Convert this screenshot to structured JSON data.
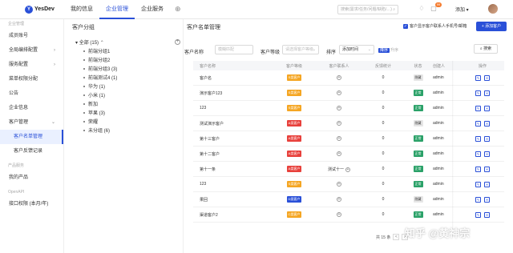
{
  "brand": {
    "name": "YesDev",
    "logo_letter": "Y"
  },
  "topnav": {
    "items": [
      "我的信息",
      "企业管理",
      "企业服务"
    ],
    "active_index": 1,
    "add_icon": "plus-icon"
  },
  "top_search": {
    "placeholder": "搜索(需求/任务/问题/缺陷/…)"
  },
  "notifications": {
    "badge": "99"
  },
  "user": {
    "label": "添加 ▾"
  },
  "sidebar": {
    "items": [
      {
        "label": "企业管理",
        "type": "group"
      },
      {
        "label": "成员账号",
        "type": "item"
      },
      {
        "label": "全局编排配置",
        "type": "item",
        "caret": "›"
      },
      {
        "label": "服务配置",
        "type": "item",
        "caret": "›"
      },
      {
        "label": "菜单权限分配",
        "type": "item"
      },
      {
        "label": "公告",
        "type": "item"
      },
      {
        "label": "企业信息",
        "type": "item"
      },
      {
        "label": "客户管理",
        "type": "item",
        "caret": "⌄"
      },
      {
        "label": "客户名单管理",
        "type": "sub",
        "active": true
      },
      {
        "label": "客户反馈记录",
        "type": "sub"
      },
      {
        "label": "产品服务",
        "type": "group"
      },
      {
        "label": "我的产品",
        "type": "item"
      },
      {
        "label": "OpenAPI",
        "type": "group"
      },
      {
        "label": "接口权限 (本月/年)",
        "type": "item"
      }
    ]
  },
  "group_panel": {
    "title": "客户分组",
    "root": "全部 (15)",
    "children": [
      "前端分组1",
      "前端分组2",
      "前端分组3 (3)",
      "前端测试4 (1)",
      "华为 (1)",
      "小米 (1)",
      "新加",
      "苹果 (3)",
      "荣耀",
      "未分组 (6)"
    ]
  },
  "main": {
    "title": "客户名单管理",
    "checkbox_label": "客户显示客户联系人手机号/邮箱",
    "add_button": "+ 添加客户",
    "filters": {
      "name_label": "客户名称",
      "name_placeholder": "模糊匹配",
      "level_label": "客户等级",
      "level_placeholder": "请选择客户等级",
      "sort_label": "排序",
      "sort_value": "添加时间",
      "sort_desc": "降序",
      "sort_asc": "升序",
      "search_button": "搜索"
    },
    "table": {
      "headers": [
        "客户名称",
        "客户等级",
        "客户联系人",
        "反馈统计",
        "状态",
        "创建人",
        "操作"
      ],
      "rows": [
        {
          "name": "客户名",
          "level": "S类客户",
          "contact": "",
          "stat": "0",
          "status": "隐藏",
          "creator": "admin"
        },
        {
          "name": "演示客户123",
          "level": "S类客户",
          "contact": "",
          "stat": "0",
          "status": "正常",
          "creator": "admin"
        },
        {
          "name": "123",
          "level": "S类客户",
          "contact": "",
          "stat": "0",
          "status": "正常",
          "creator": "admin"
        },
        {
          "name": "测试演示客户",
          "level": "A类客户",
          "contact": "",
          "stat": "0",
          "status": "隐藏",
          "creator": "admin"
        },
        {
          "name": "第十三客户",
          "level": "A类客户",
          "contact": "",
          "stat": "0",
          "status": "正常",
          "creator": "admin"
        },
        {
          "name": "第十二客户",
          "level": "A类客户",
          "contact": "",
          "stat": "0",
          "status": "正常",
          "creator": "admin"
        },
        {
          "name": "第十一条",
          "level": "A类客户",
          "contact": "测试十一",
          "stat": "0",
          "status": "正常",
          "creator": "admin"
        },
        {
          "name": "123",
          "level": "S类客户",
          "contact": "",
          "stat": "0",
          "status": "正常",
          "creator": "admin"
        },
        {
          "name": "果回",
          "level": "D类客户",
          "contact": "",
          "stat": "0",
          "status": "隐藏",
          "creator": "admin"
        },
        {
          "name": "渠道客户2",
          "level": "C类客户",
          "contact": "",
          "stat": "0",
          "status": "正常",
          "creator": "admin"
        }
      ]
    },
    "pager": {
      "total": "共 15 条",
      "prev": "<",
      "next": ">"
    }
  },
  "watermark": "知乎 @黄神宗",
  "colors": {
    "primary": "#2a50d8",
    "level_S": "#f5a623",
    "level_A": "#e8413c",
    "level_C": "#f5a623",
    "level_D": "#2a50d8",
    "status_normal": "#2aa168",
    "status_hidden": "#e6e6e6"
  }
}
